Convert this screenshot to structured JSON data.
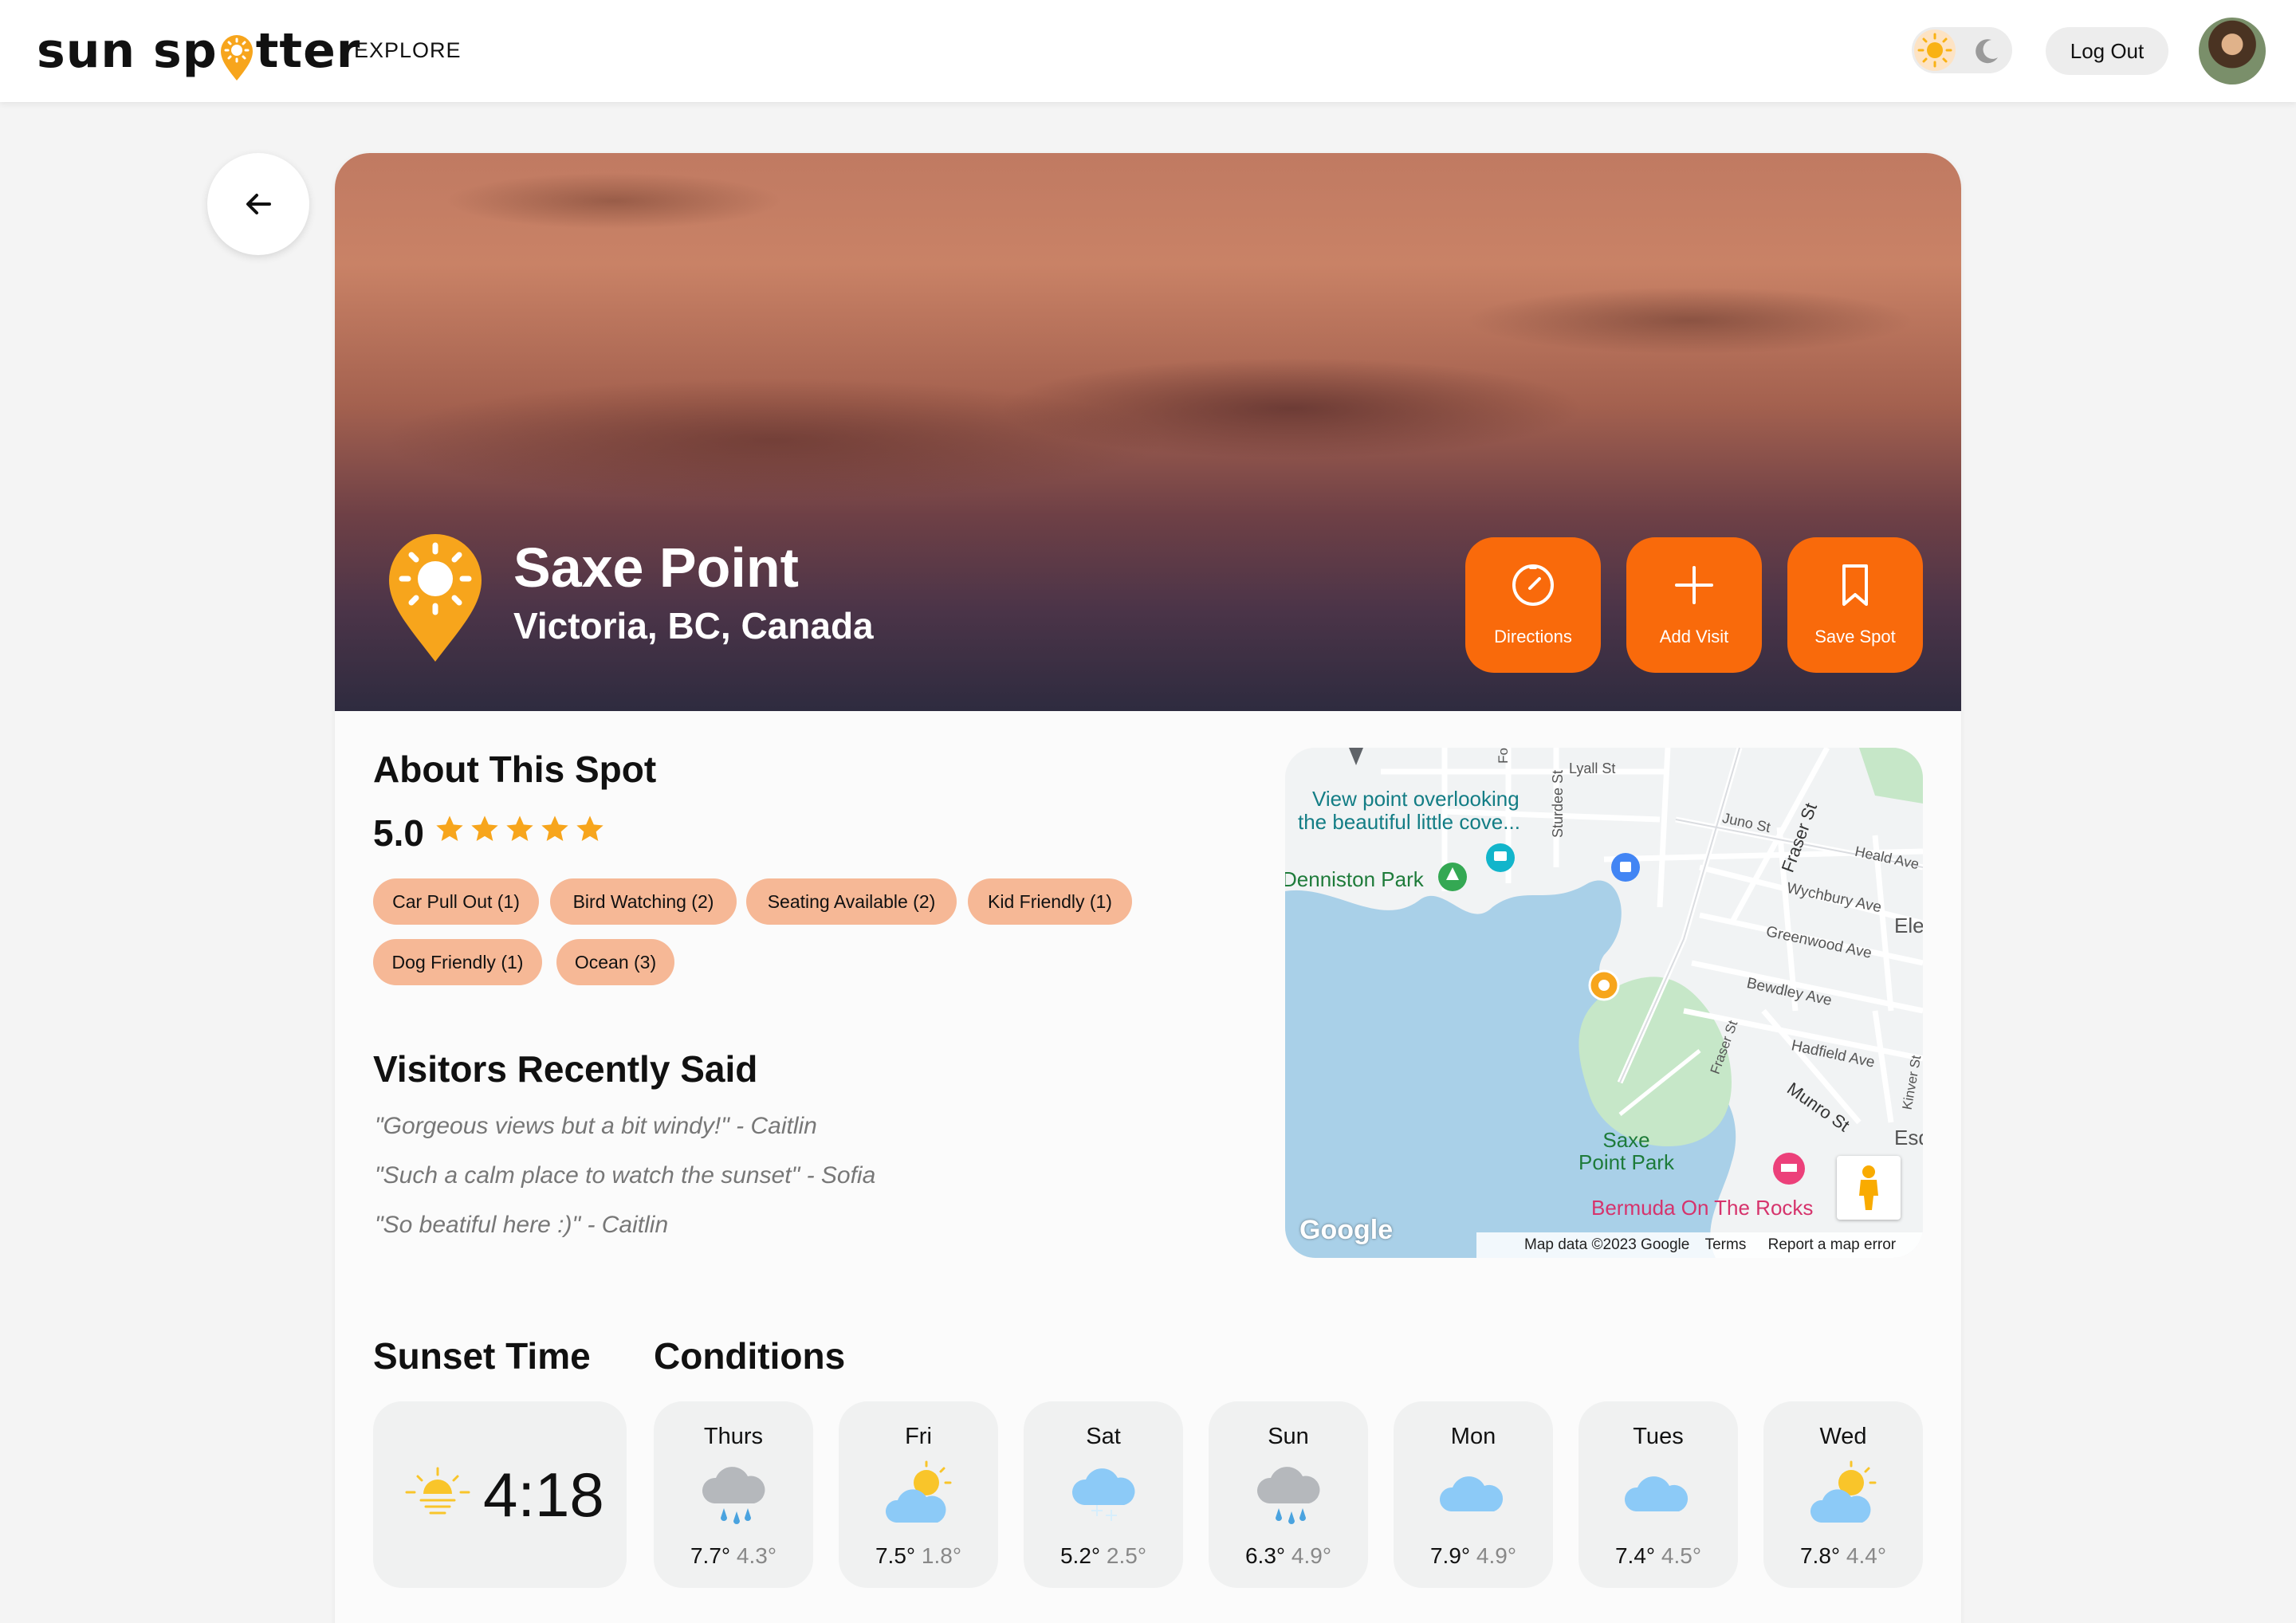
{
  "nav": {
    "logo_part1": "sun sp",
    "logo_part2": "tter",
    "explore": "EXPLORE",
    "logout": "Log Out"
  },
  "spot": {
    "name": "Saxe Point",
    "location": "Victoria, BC, Canada",
    "actions": [
      {
        "label": "Directions",
        "icon": "compass-icon"
      },
      {
        "label": "Add Visit",
        "icon": "plus-icon"
      },
      {
        "label": "Save Spot",
        "icon": "bookmark-icon"
      }
    ]
  },
  "about": {
    "title": "About This Spot",
    "rating": "5.0",
    "stars": 5,
    "tags": [
      "Car Pull Out (1)",
      "Bird Watching (2)",
      "Seating Available (2)",
      "Kid Friendly (1)",
      "Dog Friendly (1)",
      "Ocean (3)"
    ]
  },
  "visitors": {
    "title": "Visitors Recently Said",
    "quotes": [
      "\"Gorgeous views but a bit windy!\" - Caitlin",
      "\"Such a calm place to watch the sunset\" - Sofia",
      "\"So beatiful here :)\" - Caitlin"
    ]
  },
  "map": {
    "labels": {
      "viewpoint1": "View point overlooking",
      "viewpoint2": "the beautiful little cove...",
      "denniston": "Denniston Park",
      "saxe1": "Saxe",
      "saxe2": "Point Park",
      "bermuda": "Bermuda On The Rocks",
      "lyall": "Lyall St",
      "juno": "Juno St",
      "fraser": "Fraser St",
      "fraser2": "Fraser St",
      "heald": "Heald Ave",
      "wychbury": "Wychbury Ave",
      "greenwood": "Greenwood Ave",
      "bewdley": "Bewdley Ave",
      "hadfield": "Hadfield Ave",
      "munro": "Munro St",
      "sturdee": "Sturdee St",
      "kinver": "Kinver St",
      "ele": "Ele",
      "esq": "Esq",
      "fo": "Fo"
    },
    "google": "Google",
    "footer_data": "Map data ©2023 Google",
    "footer_terms": "Terms",
    "footer_report": "Report a map error"
  },
  "sunset": {
    "title": "Sunset Time",
    "time": "4:18"
  },
  "conditions": {
    "title": "Conditions",
    "days": [
      {
        "day": "Thurs",
        "hi": "7.7°",
        "lo": "4.3°",
        "icon": "rain-cloud-icon"
      },
      {
        "day": "Fri",
        "hi": "7.5°",
        "lo": "1.8°",
        "icon": "partly-sunny-icon"
      },
      {
        "day": "Sat",
        "hi": "5.2°",
        "lo": "2.5°",
        "icon": "snow-cloud-icon"
      },
      {
        "day": "Sun",
        "hi": "6.3°",
        "lo": "4.9°",
        "icon": "rain-cloud-icon"
      },
      {
        "day": "Mon",
        "hi": "7.9°",
        "lo": "4.9°",
        "icon": "cloud-icon"
      },
      {
        "day": "Tues",
        "hi": "7.4°",
        "lo": "4.5°",
        "icon": "cloud-icon"
      },
      {
        "day": "Wed",
        "hi": "7.8°",
        "lo": "4.4°",
        "icon": "partly-sunny-icon"
      }
    ]
  },
  "colors": {
    "accent": "#f96a0b",
    "tag": "#f6b896",
    "pin": "#f7a51c"
  }
}
